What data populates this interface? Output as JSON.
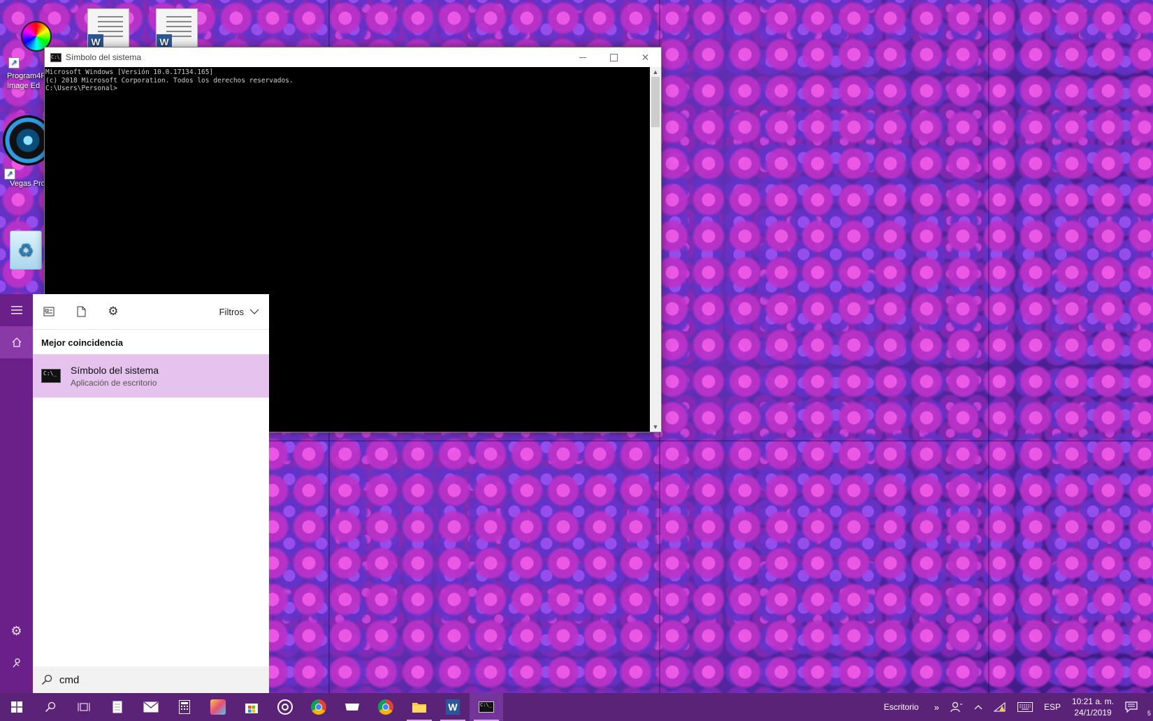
{
  "desktop": {
    "icons": [
      {
        "label": "Program4Pc Image Ed",
        "kind": "color-wheel-icon"
      },
      {
        "label": "Vegas Pro",
        "kind": "camera-lens-icon"
      },
      {
        "label": "",
        "kind": "recycle-bin-icon"
      },
      {
        "label": "",
        "kind": "word-document-icon"
      },
      {
        "label": "",
        "kind": "word-document-icon"
      }
    ]
  },
  "cmd_window": {
    "title": "Símbolo del sistema",
    "lines": [
      "Microsoft Windows [Versión 10.0.17134.165]",
      "(c) 2018 Microsoft Corporation. Todos los derechos reservados.",
      "",
      "C:\\Users\\Personal>"
    ]
  },
  "start_panel": {
    "rail": [
      "hamburger-icon",
      "home-icon",
      "gear-icon",
      "feedback-icon"
    ],
    "toolbar_icons": [
      "apps-icon",
      "documents-icon",
      "settings-icon"
    ],
    "filters_label": "Filtros",
    "section_label": "Mejor coincidencia",
    "best_match": {
      "title": "Símbolo del sistema",
      "subtitle": "Aplicación de escritorio"
    },
    "search_value": "cmd"
  },
  "taskbar": {
    "apps": [
      "start-icon",
      "search-icon",
      "task-view-icon",
      "notepad-icon",
      "mail-icon",
      "calculator-icon",
      "paint-icon",
      "store-icon",
      "groove-icon",
      "chrome-icon",
      "keyboard-app-icon",
      "chrome-icon",
      "file-explorer-icon",
      "word-icon",
      "cmd-icon"
    ],
    "toolbar_label": "Escritorio",
    "language": "ESP",
    "time": "10:21 a. m.",
    "date": "24/1/2019",
    "notification_count": "5"
  },
  "colors": {
    "taskbar": "#5b2378",
    "start_rail": "#6b1f88",
    "selection": "#e6c3ee"
  }
}
